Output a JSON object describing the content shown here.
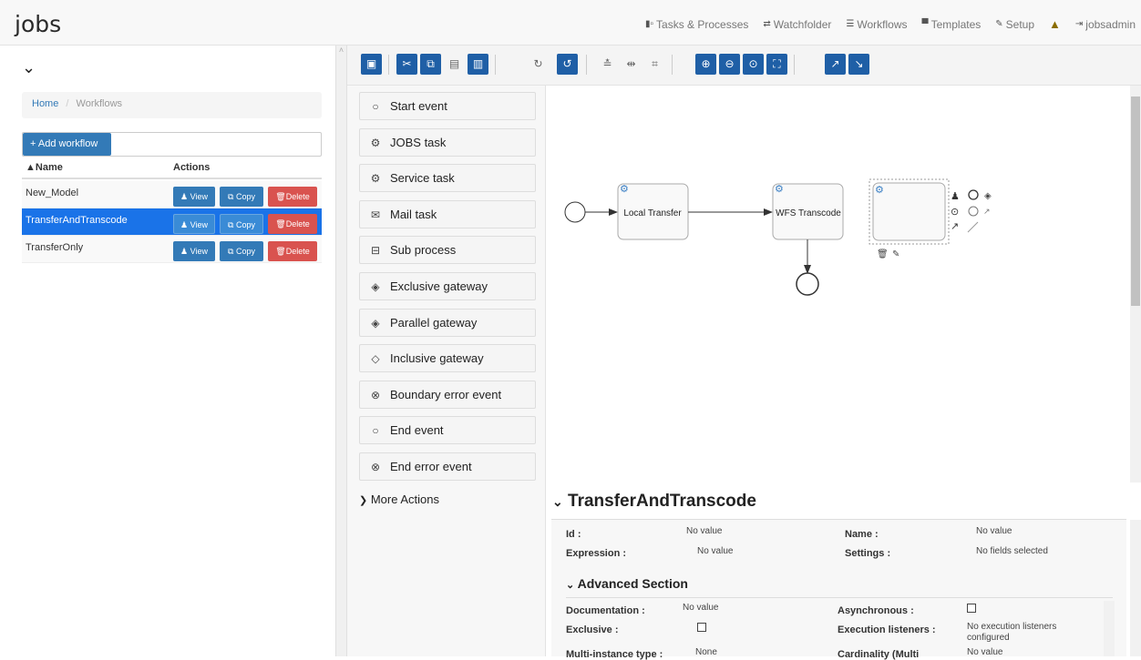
{
  "app": {
    "logo": "jobs"
  },
  "nav": {
    "items": [
      {
        "label": "Tasks & Processes",
        "icon": "tasks-icon"
      },
      {
        "label": "Watchfolder",
        "icon": "watchfolder-icon"
      },
      {
        "label": "Workflows",
        "icon": "list-icon"
      },
      {
        "label": "Templates",
        "icon": "templates-icon"
      },
      {
        "label": "Setup",
        "icon": "wrench-icon"
      },
      {
        "label": "",
        "icon": "warning-icon"
      },
      {
        "label": "jobsadmin",
        "icon": "logout-icon"
      }
    ]
  },
  "sidebar": {
    "breadcrumb": {
      "home": "Home",
      "sep": "/",
      "current": "Workflows"
    },
    "add_button": "+ Add workflow",
    "search_value": "",
    "columns": {
      "name": "▲Name",
      "actions": "Actions"
    },
    "rows": [
      {
        "name": "New_Model",
        "selected": false
      },
      {
        "name": "TransferAndTranscode",
        "selected": true
      },
      {
        "name": "TransferOnly",
        "selected": false
      }
    ],
    "view_label": "View",
    "copy_label": "Copy",
    "delete_label": "Delete"
  },
  "palette": {
    "items": [
      {
        "label": "Start event",
        "icon": "○"
      },
      {
        "label": "JOBS task",
        "icon": "⚙"
      },
      {
        "label": "Service task",
        "icon": "⚙"
      },
      {
        "label": "Mail task",
        "icon": "✉"
      },
      {
        "label": "Sub process",
        "icon": "⊟"
      },
      {
        "label": "Exclusive gateway",
        "icon": "◈"
      },
      {
        "label": "Parallel gateway",
        "icon": "◈"
      },
      {
        "label": "Inclusive gateway",
        "icon": "◇"
      },
      {
        "label": "Boundary error event",
        "icon": "⊗"
      },
      {
        "label": "End event",
        "icon": "○"
      },
      {
        "label": "End error event",
        "icon": "⊗"
      }
    ],
    "more": "More Actions"
  },
  "diagram": {
    "task1": "Local Transfer",
    "task2": "WFS Transcode"
  },
  "properties": {
    "title": "TransferAndTranscode",
    "id_label": "Id :",
    "id_value": "No value",
    "name_label": "Name :",
    "name_value": "No value",
    "expression_label": "Expression :",
    "expression_value": "No value",
    "settings_label": "Settings :",
    "settings_value": "No fields selected",
    "advanced_title": "Advanced Section",
    "documentation_label": "Documentation :",
    "documentation_value": "No value",
    "asynchronous_label": "Asynchronous :",
    "exclusive_label": "Exclusive :",
    "execution_listeners_label": "Execution listeners :",
    "execution_listeners_value": "No execution listeners configured",
    "multi_instance_label": "Multi-instance type :",
    "multi_instance_value": "None",
    "cardinality_label": "Cardinality (Multi",
    "cardinality_value": "No value"
  },
  "colors": {
    "primary": "#337ab7",
    "toolbar_btn": "#1f5fa6",
    "danger": "#d9534f",
    "selected_row": "#1a73e8"
  }
}
